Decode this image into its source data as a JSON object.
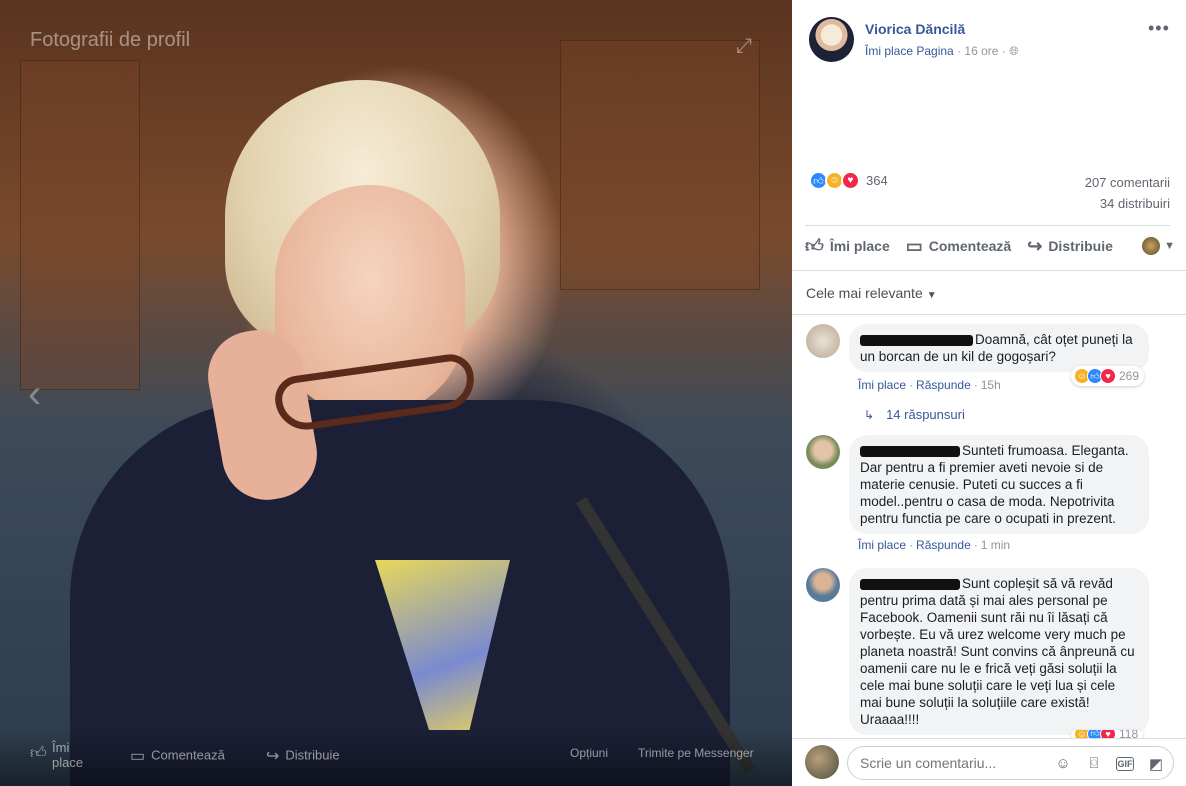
{
  "viewer": {
    "title": "Fotografii de profil",
    "like_label": "Îmi place",
    "comment_label": "Comentează",
    "share_label": "Distribuie",
    "options_label": "Opțiuni",
    "messenger_label": "Trimite pe Messenger"
  },
  "post": {
    "author": "Viorica Dăncilă",
    "page_like_label": "Îmi place Pagina",
    "separator": "·",
    "time": "16 ore",
    "reaction_count": "364",
    "comment_count": "207 comentarii",
    "share_count": "34 distribuiri"
  },
  "actions": {
    "like": "Îmi place",
    "comment": "Comentează",
    "share": "Distribuie"
  },
  "sort": {
    "label": "Cele mai relevante"
  },
  "comments": [
    {
      "text": "Doamnă, cât oțet puneți la un borcan de un kil de gogoșari?",
      "like_label": "Îmi place",
      "reply_label": "Răspunde",
      "time": "15h",
      "reaction_count": "269"
    },
    {
      "text": "Sunteti frumoasa. Eleganta. Dar pentru a fi premier aveti nevoie si de materie cenusie. Puteti cu succes a fi model..pentru o casa de moda. Nepotrivita pentru functia pe care o ocupati in prezent.",
      "like_label": "Îmi place",
      "reply_label": "Răspunde",
      "time": "1 min"
    },
    {
      "text": "Sunt copleșit să vă revăd pentru prima dată și mai ales personal pe Facebook. Oamenii sunt răi nu îi lăsați că vorbește. Eu vă urez welcome very much pe planeta noastră! Sunt convins că ânpreună cu oamenii care nu le e frică veți găsi soluții la cele mai bune soluții care le veți lua și cele mai bune soluții la soluțiile care există! Uraaaa!!!!",
      "reaction_count": "118"
    }
  ],
  "replies": {
    "label": "14 răspunsuri"
  },
  "compose": {
    "placeholder": "Scrie un comentariu..."
  },
  "colors": {
    "link": "#365899",
    "muted": "#90949c",
    "like_blue": "#2d88ff",
    "love_red": "#f0284a",
    "haha_yellow": "#f7b125"
  },
  "icons": [
    "expand-icon",
    "chevron-left-icon",
    "thumbs-up-icon",
    "comment-icon",
    "share-icon",
    "globe-icon",
    "more-icon",
    "emoji-icon",
    "camera-icon",
    "gif-icon",
    "sticker-icon"
  ]
}
